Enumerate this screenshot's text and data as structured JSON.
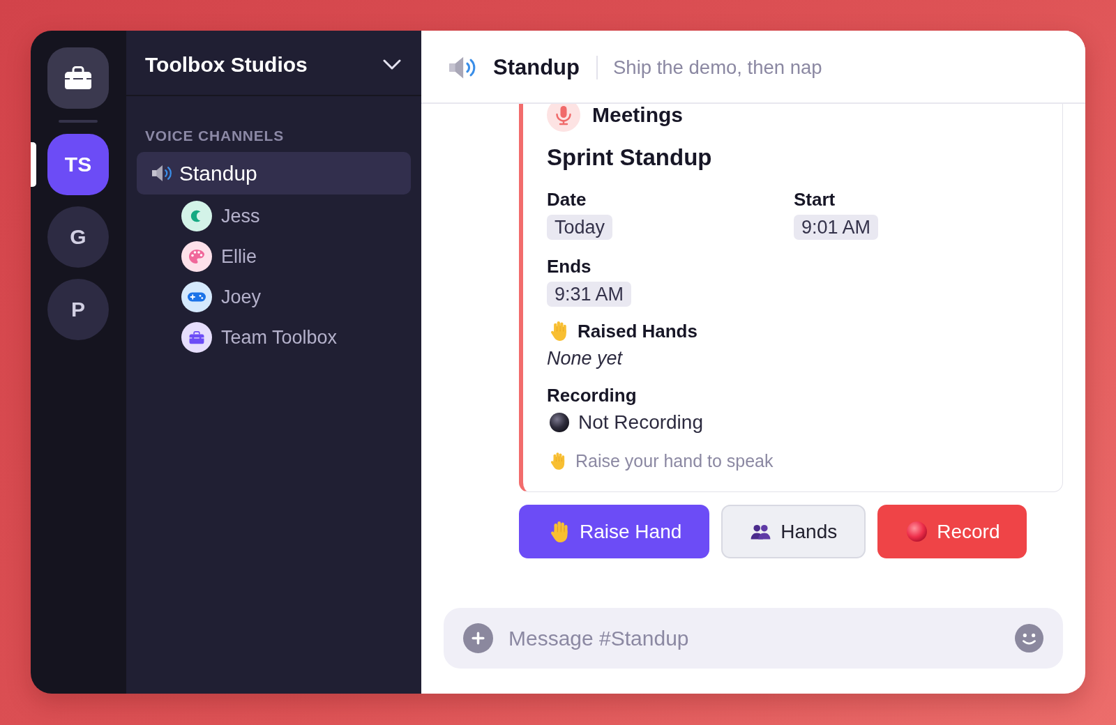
{
  "server_rail": {
    "servers": [
      {
        "label": "TS",
        "selected": true
      },
      {
        "label": "G",
        "selected": false
      },
      {
        "label": "P",
        "selected": false
      }
    ]
  },
  "sidebar": {
    "server_name": "Toolbox Studios",
    "section_title": "VOICE CHANNELS",
    "channels": [
      {
        "name": "Standup",
        "selected": true,
        "members": [
          {
            "name": "Jess",
            "kind": "moon",
            "color": "#d3f3e8"
          },
          {
            "name": "Ellie",
            "kind": "palette",
            "color": "#fde1ea"
          },
          {
            "name": "Joey",
            "kind": "gamepad",
            "color": "#d5e9fd"
          },
          {
            "name": "Team Toolbox",
            "kind": "toolbox",
            "color": "#e6defc"
          }
        ]
      }
    ]
  },
  "channel_header": {
    "name": "Standup",
    "topic": "Ship the demo, then nap"
  },
  "event_card": {
    "app_name": "Meetings",
    "title": "Sprint Standup",
    "fields": [
      {
        "label": "Date",
        "value": "Today"
      },
      {
        "label": "Start",
        "value": "9:01 AM"
      },
      {
        "label": "Ends",
        "value": "9:31 AM"
      }
    ],
    "raised_hands": {
      "label": "Raised Hands",
      "value": "None yet"
    },
    "recording": {
      "label": "Recording",
      "status": "Not Recording",
      "on": false
    },
    "hint": "Raise your hand to speak"
  },
  "buttons": [
    {
      "label": "Raise Hand",
      "kind": "primary"
    },
    {
      "label": "Hands",
      "kind": "secondary"
    },
    {
      "label": "Record",
      "kind": "danger"
    }
  ],
  "composer": {
    "placeholder": "Message #Standup"
  }
}
